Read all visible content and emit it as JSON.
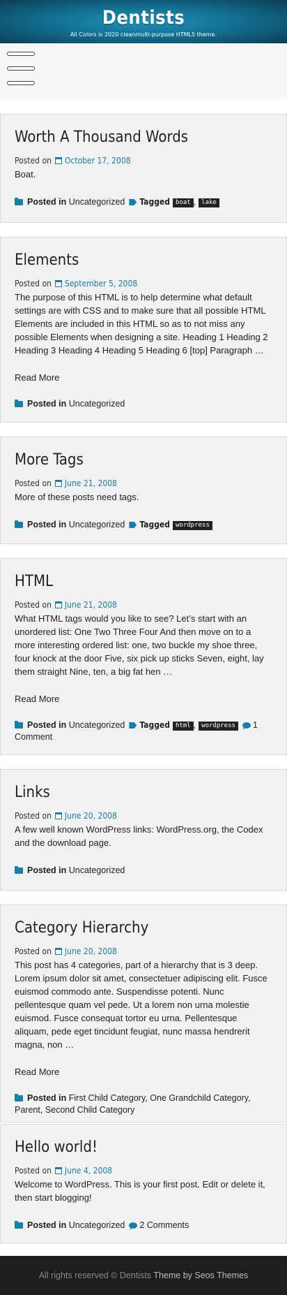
{
  "header": {
    "title": "Dentists",
    "description": "All Colors is 2020 cleanmulti-purpose HTML5 theme."
  },
  "labels": {
    "posted_on": "Posted on",
    "posted_in": "Posted in",
    "tagged": "Tagged",
    "read_more": "Read More"
  },
  "posts": [
    {
      "title": "Worth A Thousand Words",
      "date": "October 17, 2008",
      "excerpt": "Boat.",
      "categories": "Uncategorized",
      "tags": [
        "boat",
        "lake"
      ]
    },
    {
      "title": "Elements",
      "date": "September 5, 2008",
      "excerpt": "The purpose of this HTML is to help determine what default settings are with CSS and to make sure that all possible HTML Elements are included in this HTML so as to not miss any possible Elements when designing a site. Heading 1 Heading 2 Heading 3 Heading 4 Heading 5 Heading 6 [top] Paragraph …",
      "categories": "Uncategorized"
    },
    {
      "title": "More Tags",
      "date": "June 21, 2008",
      "excerpt": "More of these posts need tags.",
      "categories": "Uncategorized",
      "tags": [
        "wordpress"
      ]
    },
    {
      "title": "HTML",
      "date": "June 21, 2008",
      "excerpt": "What HTML tags would you like to see? Let’s start with an unordered list: One Two Three Four And then move on to a more interesting ordered list: one, two buckle my shoe three, four knock at the door Five, six pick up sticks Seven, eight, lay them straight Nine, ten, a big fat hen …",
      "categories": "Uncategorized",
      "tags": [
        "html",
        "wordpress"
      ],
      "comments": "1 Comment"
    },
    {
      "title": "Links",
      "date": "June 20, 2008",
      "excerpt": "A few well known WordPress links: WordPress.org, the Codex and the download page.",
      "categories": "Uncategorized"
    },
    {
      "title": "Category Hierarchy",
      "date": "June 20, 2008",
      "excerpt": "This post has 4 categories, part of a hierarchy that is 3 deep. Lorem ipsum dolor sit amet, consectetuer adipiscing elit. Fusce euismod commodo ante. Suspendisse potenti. Nunc pellentesque quam vel pede. Ut a lorem non urna molestie euismod. Fusce consequat tortor eu urna. Pellentesque aliquam, pede eget tincidunt feugiat, nunc massa hendrerit magna, non …",
      "cat1": "First Child Category",
      "cat2": "One Grandchild Category",
      "cat3": "Parent",
      "cat4": "Second Child Category"
    },
    {
      "title": "Hello world!",
      "date": "June 4, 2008",
      "excerpt": "Welcome to WordPress. This is your first post. Edit or delete it, then start blogging!",
      "categories": "Uncategorized",
      "comments": "2 Comments"
    }
  ],
  "footer": {
    "rights": "All rights reserved ©",
    "site": "Dentists",
    "theme_by": "Theme by",
    "author": "Seos Themes"
  },
  "colors": {
    "accent": "#1a7fa6",
    "header_bg": "#137193",
    "post_bg": "#f2f2f2",
    "footer_bg": "#1e1e1e"
  }
}
